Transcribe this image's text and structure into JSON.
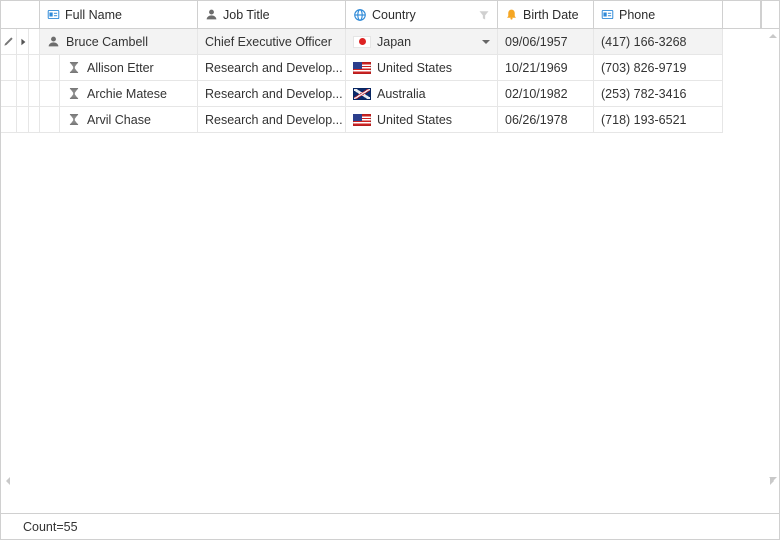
{
  "columns": {
    "fullName": "Full Name",
    "jobTitle": "Job Title",
    "country": "Country",
    "birthDate": "Birth Date",
    "phone": "Phone"
  },
  "rows": [
    {
      "name": "Bruce Cambell",
      "job": "Chief Executive Officer",
      "country": "Japan",
      "flag": "jp",
      "birth": "09/06/1957",
      "phone": "(417) 166-3268",
      "selected": true,
      "editing": true,
      "expandable": true,
      "level": 0,
      "personIcon": true
    },
    {
      "name": "Allison Etter",
      "job": "Research and Develop...",
      "country": "United States",
      "flag": "us",
      "birth": "10/21/1969",
      "phone": "(703) 826-9719",
      "selected": false,
      "level": 1,
      "jobIcon": true
    },
    {
      "name": "Archie Matese",
      "job": "Research and Develop...",
      "country": "Australia",
      "flag": "au",
      "birth": "02/10/1982",
      "phone": "(253) 782-3416",
      "selected": false,
      "level": 1,
      "jobIcon": true
    },
    {
      "name": "Arvil Chase",
      "job": "Research and Develop...",
      "country": "United States",
      "flag": "us",
      "birth": "06/26/1978",
      "phone": "(718) 193-6521",
      "selected": false,
      "level": 1,
      "jobIcon": true
    }
  ],
  "footer": {
    "summary": "Count=55"
  }
}
